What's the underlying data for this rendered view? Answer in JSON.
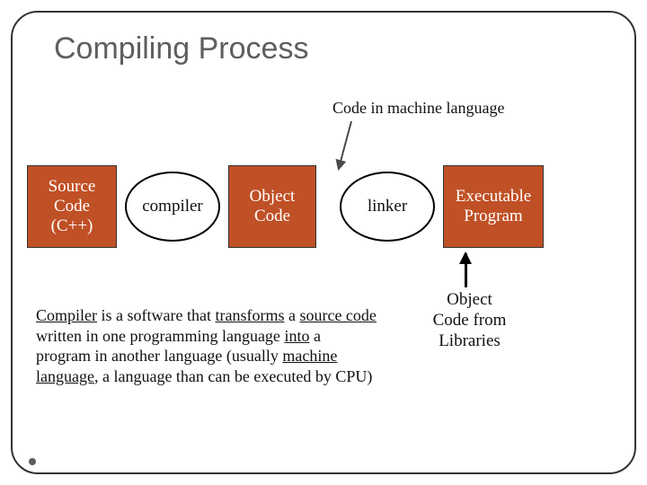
{
  "title": "Compiling Process",
  "annotation": "Code in machine language",
  "flow": {
    "source": "Source\nCode\n(C++)",
    "compiler": "compiler",
    "object": "Object\nCode",
    "linker": "linker",
    "exec": "Executable\nProgram"
  },
  "libraries": "Object\nCode from\nLibraries",
  "description_html": "<span class='u'>Compiler</span> is a software that <span class='u'>transforms</span> a <span class='u'>source code</span> written in one programming language <span class='u'>into</span> a program in another language (usually <span class='u'>machine language</span>, a language than can be executed by CPU)"
}
